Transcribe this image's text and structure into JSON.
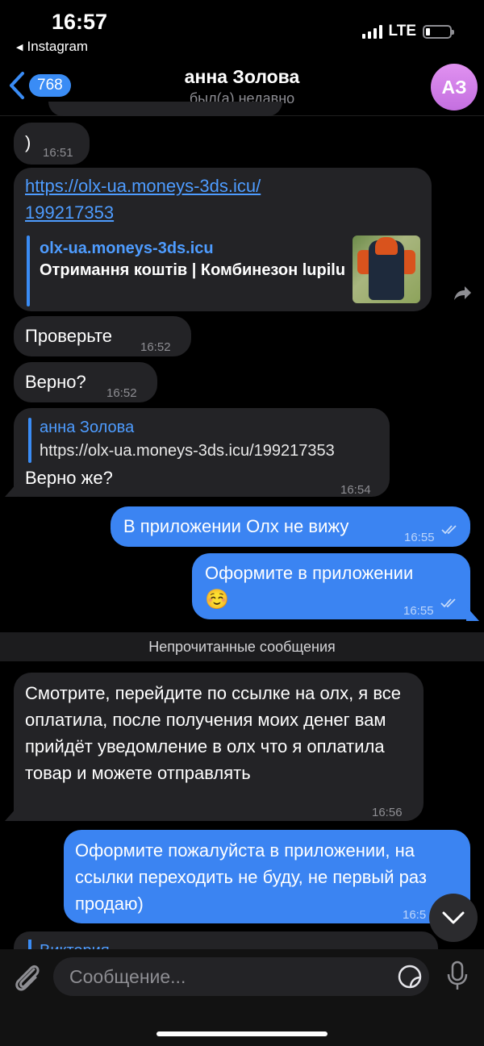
{
  "status": {
    "time": "16:57",
    "back_app": "Instagram",
    "network": "LTE"
  },
  "header": {
    "back_count": "768",
    "contact_name": "анна Золова",
    "last_seen": "был(а) недавно",
    "avatar_initials": "АЗ"
  },
  "messages": [
    {
      "text": ")",
      "time": "16:51"
    },
    {
      "link_line1": "https://olx-ua.moneys-3ds.icu/",
      "link_line2": "199217353",
      "preview_site": "olx-ua.moneys-3ds.icu",
      "preview_title": "Отримання коштів | Комбинезон lupilu"
    },
    {
      "text": "Проверьте",
      "time": "16:52"
    },
    {
      "text": "Верно?",
      "time": "16:52"
    },
    {
      "reply_name": "анна Золова",
      "reply_text": "https://olx-ua.moneys-3ds.icu/199217353",
      "text": "Верно же?",
      "time": "16:54"
    },
    {
      "text": "В приложении Олх не вижу",
      "time": "16:55"
    },
    {
      "text": "Оформите в приложении",
      "emoji": "☺️",
      "time": "16:55"
    },
    {
      "text": "Смотрите, перейдите по ссылке на олх, я все оплатила, после получения моих денег вам прийдёт уведомление в олх что я оплатила товар и можете отправлять",
      "time": "16:56"
    },
    {
      "text": "Оформите пожалуйста в приложении, на ссылки переходить не буду, не первый раз продаю)",
      "time": "16:5"
    },
    {
      "reply_name_partial": "Виктория"
    }
  ],
  "unread_banner": "Непрочитанные сообщения",
  "composer": {
    "placeholder": "Сообщение..."
  },
  "colors": {
    "outgoing": "#3b84f2",
    "incoming": "#232326",
    "accent": "#4e9cff",
    "avatar": "#d47ee8"
  },
  "icons": [
    "back-chevron-icon",
    "share-icon",
    "scroll-down-chevron-icon",
    "attach-paperclip-icon",
    "sticker-icon",
    "microphone-icon",
    "signal-bars-icon",
    "battery-icon"
  ]
}
